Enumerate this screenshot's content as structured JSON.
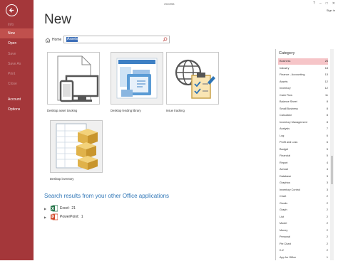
{
  "window": {
    "title": "Access",
    "controls": [
      "?",
      "–",
      "□",
      "✕"
    ],
    "user": "Sign in"
  },
  "sidebar": {
    "items": [
      {
        "label": "Info",
        "state": "disabled"
      },
      {
        "label": "New",
        "state": "selected"
      },
      {
        "label": "Open",
        "state": "normal"
      },
      {
        "label": "Save",
        "state": "disabled"
      },
      {
        "label": "Save As",
        "state": "disabled"
      },
      {
        "label": "Print",
        "state": "disabled"
      },
      {
        "label": "Close",
        "state": "disabled"
      },
      {
        "label": "Account",
        "state": "normal"
      },
      {
        "label": "Options",
        "state": "normal"
      }
    ]
  },
  "main": {
    "title": "New",
    "home_label": "Home",
    "search": {
      "value": "Assets",
      "placeholder": ""
    },
    "templates": [
      {
        "label": "Desktop asset tracking",
        "icon": "desktop-asset-icon"
      },
      {
        "label": "Desktop lending library",
        "icon": "library-icon"
      },
      {
        "label": "Issue tracking",
        "icon": "issue-tracking-icon"
      },
      {
        "label": "Desktop inventory",
        "icon": "inventory-boxes-icon"
      }
    ],
    "other_apps_header": "Search results from your other Office applications",
    "other_apps": [
      {
        "app": "Excel",
        "count": "21",
        "color": "#207245"
      },
      {
        "app": "PowerPoint",
        "count": "1",
        "color": "#d24726"
      }
    ]
  },
  "category": {
    "header": "Category",
    "items": [
      {
        "name": "Business",
        "count": "26",
        "selected": true
      },
      {
        "name": "Industry",
        "count": "18"
      },
      {
        "name": "Finance - Accounting",
        "count": "13"
      },
      {
        "name": "Assets",
        "count": "12"
      },
      {
        "name": "Inventory",
        "count": "12"
      },
      {
        "name": "Cash Flow",
        "count": "11"
      },
      {
        "name": "Balance Sheet",
        "count": "8"
      },
      {
        "name": "Small Business",
        "count": "8"
      },
      {
        "name": "Calculator",
        "count": "8"
      },
      {
        "name": "Inventory Management",
        "count": "8"
      },
      {
        "name": "Analysis",
        "count": "7"
      },
      {
        "name": "Log",
        "count": "6"
      },
      {
        "name": "Profit and Loss",
        "count": "6"
      },
      {
        "name": "Budget",
        "count": "5"
      },
      {
        "name": "Financial",
        "count": "5"
      },
      {
        "name": "Report",
        "count": "4"
      },
      {
        "name": "Annual",
        "count": "4"
      },
      {
        "name": "Database",
        "count": "3"
      },
      {
        "name": "Graphics",
        "count": "3"
      },
      {
        "name": "Inventory Control",
        "count": "3"
      },
      {
        "name": "Chart",
        "count": "2"
      },
      {
        "name": "Goods",
        "count": "2"
      },
      {
        "name": "Graph",
        "count": "2"
      },
      {
        "name": "List",
        "count": "2"
      },
      {
        "name": "Model",
        "count": "2"
      },
      {
        "name": "Money",
        "count": "2"
      },
      {
        "name": "Personal",
        "count": "2"
      },
      {
        "name": "Pie Chart",
        "count": "2"
      },
      {
        "name": "K-2",
        "count": "2"
      },
      {
        "name": "App for Office",
        "count": "1"
      }
    ]
  },
  "colors": {
    "accent": "#a4373a",
    "link": "#2e75b6",
    "category_selected": "#f6c5c8"
  }
}
